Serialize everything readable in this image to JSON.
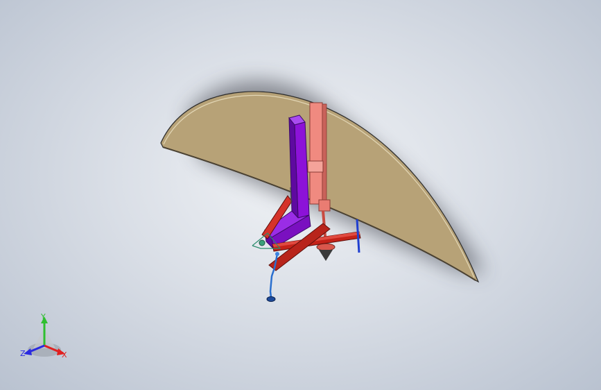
{
  "view": {
    "background": "#d9dee6"
  },
  "triad": {
    "x_label": "X",
    "y_label": "Y",
    "z_label": "Z",
    "colors": {
      "x": "#e02020",
      "y": "#2fbf2f",
      "z": "#2a2ae0"
    }
  },
  "model": {
    "parts": [
      {
        "name": "curved-plate",
        "color": "#b7a277"
      },
      {
        "name": "purple-l-bracket",
        "color": "#8c12d8"
      },
      {
        "name": "salmon-vertical-rod",
        "color": "#f08a80"
      },
      {
        "name": "red-lever-arms",
        "color": "#c42218"
      },
      {
        "name": "blue-connecting-rod",
        "color": "#2a6fcf"
      }
    ]
  }
}
